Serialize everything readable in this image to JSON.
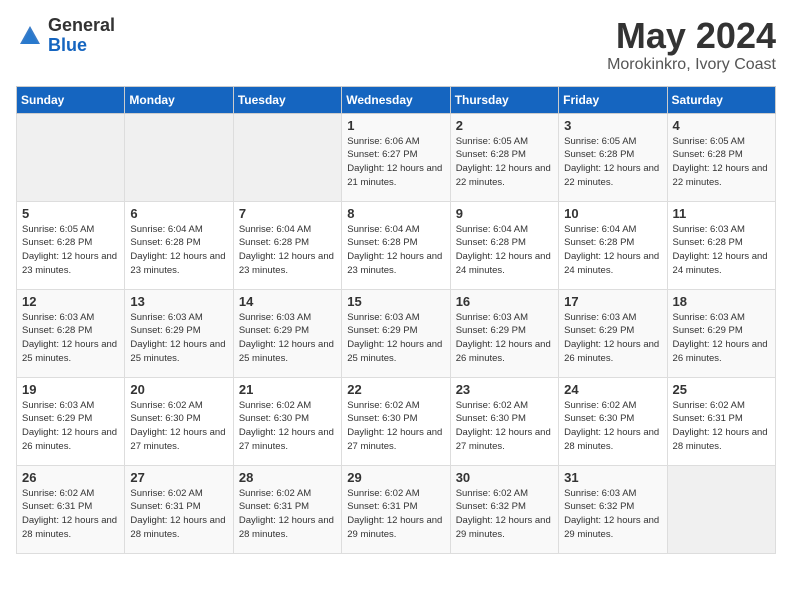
{
  "header": {
    "logo_general": "General",
    "logo_blue": "Blue",
    "month_year": "May 2024",
    "location": "Morokinkro, Ivory Coast"
  },
  "calendar": {
    "weekdays": [
      "Sunday",
      "Monday",
      "Tuesday",
      "Wednesday",
      "Thursday",
      "Friday",
      "Saturday"
    ],
    "weeks": [
      [
        {
          "day": "",
          "sunrise": "",
          "sunset": "",
          "daylight": ""
        },
        {
          "day": "",
          "sunrise": "",
          "sunset": "",
          "daylight": ""
        },
        {
          "day": "",
          "sunrise": "",
          "sunset": "",
          "daylight": ""
        },
        {
          "day": "1",
          "sunrise": "Sunrise: 6:06 AM",
          "sunset": "Sunset: 6:27 PM",
          "daylight": "Daylight: 12 hours and 21 minutes."
        },
        {
          "day": "2",
          "sunrise": "Sunrise: 6:05 AM",
          "sunset": "Sunset: 6:28 PM",
          "daylight": "Daylight: 12 hours and 22 minutes."
        },
        {
          "day": "3",
          "sunrise": "Sunrise: 6:05 AM",
          "sunset": "Sunset: 6:28 PM",
          "daylight": "Daylight: 12 hours and 22 minutes."
        },
        {
          "day": "4",
          "sunrise": "Sunrise: 6:05 AM",
          "sunset": "Sunset: 6:28 PM",
          "daylight": "Daylight: 12 hours and 22 minutes."
        }
      ],
      [
        {
          "day": "5",
          "sunrise": "Sunrise: 6:05 AM",
          "sunset": "Sunset: 6:28 PM",
          "daylight": "Daylight: 12 hours and 23 minutes."
        },
        {
          "day": "6",
          "sunrise": "Sunrise: 6:04 AM",
          "sunset": "Sunset: 6:28 PM",
          "daylight": "Daylight: 12 hours and 23 minutes."
        },
        {
          "day": "7",
          "sunrise": "Sunrise: 6:04 AM",
          "sunset": "Sunset: 6:28 PM",
          "daylight": "Daylight: 12 hours and 23 minutes."
        },
        {
          "day": "8",
          "sunrise": "Sunrise: 6:04 AM",
          "sunset": "Sunset: 6:28 PM",
          "daylight": "Daylight: 12 hours and 23 minutes."
        },
        {
          "day": "9",
          "sunrise": "Sunrise: 6:04 AM",
          "sunset": "Sunset: 6:28 PM",
          "daylight": "Daylight: 12 hours and 24 minutes."
        },
        {
          "day": "10",
          "sunrise": "Sunrise: 6:04 AM",
          "sunset": "Sunset: 6:28 PM",
          "daylight": "Daylight: 12 hours and 24 minutes."
        },
        {
          "day": "11",
          "sunrise": "Sunrise: 6:03 AM",
          "sunset": "Sunset: 6:28 PM",
          "daylight": "Daylight: 12 hours and 24 minutes."
        }
      ],
      [
        {
          "day": "12",
          "sunrise": "Sunrise: 6:03 AM",
          "sunset": "Sunset: 6:28 PM",
          "daylight": "Daylight: 12 hours and 25 minutes."
        },
        {
          "day": "13",
          "sunrise": "Sunrise: 6:03 AM",
          "sunset": "Sunset: 6:29 PM",
          "daylight": "Daylight: 12 hours and 25 minutes."
        },
        {
          "day": "14",
          "sunrise": "Sunrise: 6:03 AM",
          "sunset": "Sunset: 6:29 PM",
          "daylight": "Daylight: 12 hours and 25 minutes."
        },
        {
          "day": "15",
          "sunrise": "Sunrise: 6:03 AM",
          "sunset": "Sunset: 6:29 PM",
          "daylight": "Daylight: 12 hours and 25 minutes."
        },
        {
          "day": "16",
          "sunrise": "Sunrise: 6:03 AM",
          "sunset": "Sunset: 6:29 PM",
          "daylight": "Daylight: 12 hours and 26 minutes."
        },
        {
          "day": "17",
          "sunrise": "Sunrise: 6:03 AM",
          "sunset": "Sunset: 6:29 PM",
          "daylight": "Daylight: 12 hours and 26 minutes."
        },
        {
          "day": "18",
          "sunrise": "Sunrise: 6:03 AM",
          "sunset": "Sunset: 6:29 PM",
          "daylight": "Daylight: 12 hours and 26 minutes."
        }
      ],
      [
        {
          "day": "19",
          "sunrise": "Sunrise: 6:03 AM",
          "sunset": "Sunset: 6:29 PM",
          "daylight": "Daylight: 12 hours and 26 minutes."
        },
        {
          "day": "20",
          "sunrise": "Sunrise: 6:02 AM",
          "sunset": "Sunset: 6:30 PM",
          "daylight": "Daylight: 12 hours and 27 minutes."
        },
        {
          "day": "21",
          "sunrise": "Sunrise: 6:02 AM",
          "sunset": "Sunset: 6:30 PM",
          "daylight": "Daylight: 12 hours and 27 minutes."
        },
        {
          "day": "22",
          "sunrise": "Sunrise: 6:02 AM",
          "sunset": "Sunset: 6:30 PM",
          "daylight": "Daylight: 12 hours and 27 minutes."
        },
        {
          "day": "23",
          "sunrise": "Sunrise: 6:02 AM",
          "sunset": "Sunset: 6:30 PM",
          "daylight": "Daylight: 12 hours and 27 minutes."
        },
        {
          "day": "24",
          "sunrise": "Sunrise: 6:02 AM",
          "sunset": "Sunset: 6:30 PM",
          "daylight": "Daylight: 12 hours and 28 minutes."
        },
        {
          "day": "25",
          "sunrise": "Sunrise: 6:02 AM",
          "sunset": "Sunset: 6:31 PM",
          "daylight": "Daylight: 12 hours and 28 minutes."
        }
      ],
      [
        {
          "day": "26",
          "sunrise": "Sunrise: 6:02 AM",
          "sunset": "Sunset: 6:31 PM",
          "daylight": "Daylight: 12 hours and 28 minutes."
        },
        {
          "day": "27",
          "sunrise": "Sunrise: 6:02 AM",
          "sunset": "Sunset: 6:31 PM",
          "daylight": "Daylight: 12 hours and 28 minutes."
        },
        {
          "day": "28",
          "sunrise": "Sunrise: 6:02 AM",
          "sunset": "Sunset: 6:31 PM",
          "daylight": "Daylight: 12 hours and 28 minutes."
        },
        {
          "day": "29",
          "sunrise": "Sunrise: 6:02 AM",
          "sunset": "Sunset: 6:31 PM",
          "daylight": "Daylight: 12 hours and 29 minutes."
        },
        {
          "day": "30",
          "sunrise": "Sunrise: 6:02 AM",
          "sunset": "Sunset: 6:32 PM",
          "daylight": "Daylight: 12 hours and 29 minutes."
        },
        {
          "day": "31",
          "sunrise": "Sunrise: 6:03 AM",
          "sunset": "Sunset: 6:32 PM",
          "daylight": "Daylight: 12 hours and 29 minutes."
        },
        {
          "day": "",
          "sunrise": "",
          "sunset": "",
          "daylight": ""
        }
      ]
    ]
  }
}
